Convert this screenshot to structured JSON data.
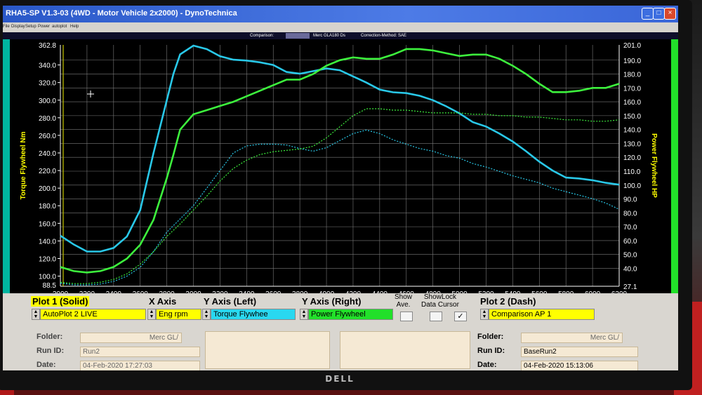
{
  "window": {
    "title": "RHA5-SP V1.3-03   (4WD - Motor Vehicle 2x2000) - DynoTechnica",
    "minimize": "_",
    "maximize": "□",
    "close": "×"
  },
  "menu": [
    "File",
    "Display",
    "Setup",
    "Power",
    "autoplot",
    "Help"
  ],
  "info_bar": {
    "comparison_label": "Comparison:",
    "comparison_value": "Merc GLA180 Ds",
    "correction": "Correction-Method: SAE"
  },
  "colors": {
    "plot_bg": "#000000",
    "torque": "#29c8e8",
    "power": "#3df23d",
    "axis_label": "#ffff00",
    "grid": "#7a7a7a"
  },
  "chart_data": {
    "type": "line",
    "xlabel": "",
    "ylabel": "Torque Flywheel Nm",
    "y2label": "Power Flywheel HP",
    "xlim": [
      2000,
      6200
    ],
    "ylim": [
      88.5,
      362.8
    ],
    "y2lim": [
      27.1,
      201.0
    ],
    "x_ticks": [
      2000,
      2200,
      2400,
      2600,
      2800,
      3000,
      3200,
      3400,
      3600,
      3800,
      4000,
      4200,
      4400,
      4600,
      4800,
      5000,
      5200,
      5400,
      5600,
      5800,
      6000,
      6200
    ],
    "y_ticks": [
      100.0,
      120.0,
      140.0,
      160.0,
      180.0,
      200.0,
      220.0,
      240.0,
      260.0,
      280.0,
      300.0,
      320.0,
      340.0
    ],
    "y_tick_labels": [
      "100.0",
      "120.0",
      "140.0",
      "160.0",
      "180.0",
      "200.0",
      "220.0",
      "240.0",
      "260.0",
      "280.0",
      "300.0",
      "320.0",
      "340.0"
    ],
    "y_top_label": "362.8",
    "y_bottom_label": "88.5",
    "y2_ticks": [
      40.0,
      50.0,
      60.0,
      70.0,
      80.0,
      90.0,
      100.0,
      110.0,
      120.0,
      130.0,
      140.0,
      150.0,
      160.0,
      170.0,
      180.0,
      190.0
    ],
    "y2_tick_labels": [
      "40.0",
      "50.0",
      "60.0",
      "70.0",
      "80.0",
      "90.0",
      "100.0",
      "110.0",
      "120.0",
      "130.0",
      "140.0",
      "150.0",
      "160.0",
      "170.0",
      "180.0",
      "190.0"
    ],
    "y2_top_label": "201.0",
    "y2_bottom_label": "27.1",
    "series": [
      {
        "axis": "left",
        "style": "solid",
        "color": "#29c8e8",
        "x": [
          2000,
          2100,
          2200,
          2300,
          2400,
          2500,
          2600,
          2700,
          2800,
          2850,
          2900,
          3000,
          3100,
          3200,
          3300,
          3400,
          3500,
          3600,
          3700,
          3800,
          3900,
          4000,
          4100,
          4200,
          4300,
          4400,
          4500,
          4600,
          4700,
          4800,
          4900,
          5000,
          5100,
          5200,
          5300,
          5400,
          5500,
          5600,
          5700,
          5800,
          5900,
          6000,
          6100,
          6200
        ],
        "y": [
          146,
          136,
          128,
          128,
          132,
          145,
          175,
          240,
          300,
          330,
          352,
          362,
          358,
          350,
          346,
          345,
          343,
          340,
          332,
          330,
          333,
          336,
          334,
          327,
          320,
          312,
          309,
          308,
          305,
          300,
          293,
          285,
          275,
          270,
          262,
          253,
          242,
          230,
          220,
          212,
          211,
          209,
          206,
          204
        ]
      },
      {
        "axis": "right",
        "style": "solid",
        "color": "#3df23d",
        "x": [
          2000,
          2100,
          2200,
          2300,
          2400,
          2500,
          2600,
          2700,
          2800,
          2850,
          2900,
          3000,
          3100,
          3200,
          3300,
          3400,
          3500,
          3600,
          3700,
          3800,
          3900,
          4000,
          4100,
          4200,
          4300,
          4400,
          4500,
          4600,
          4700,
          4800,
          4900,
          5000,
          5100,
          5200,
          5300,
          5400,
          5500,
          5600,
          5700,
          5800,
          5900,
          6000,
          6100,
          6200
        ],
        "y": [
          41,
          38,
          37,
          38,
          41,
          47,
          57,
          75,
          105,
          122,
          140,
          151,
          154,
          157,
          160,
          164,
          168,
          172,
          176,
          176,
          180,
          186,
          190,
          192,
          191,
          191,
          194,
          198,
          198,
          197,
          195,
          193,
          194,
          194,
          191,
          186,
          180,
          173,
          167,
          167,
          168,
          170,
          170,
          173
        ]
      },
      {
        "axis": "left",
        "style": "dash",
        "color": "#29c8e8",
        "x": [
          2000,
          2100,
          2200,
          2300,
          2400,
          2500,
          2600,
          2700,
          2800,
          2900,
          3000,
          3100,
          3200,
          3300,
          3400,
          3500,
          3600,
          3700,
          3800,
          3900,
          4000,
          4100,
          4200,
          4300,
          4400,
          4500,
          4600,
          4700,
          4800,
          4900,
          5000,
          5100,
          5200,
          5300,
          5400,
          5500,
          5600,
          5700,
          5800,
          5900,
          6000,
          6100,
          6200
        ],
        "y": [
          92,
          90,
          90,
          91,
          94,
          100,
          110,
          128,
          150,
          165,
          180,
          200,
          220,
          240,
          248,
          250,
          250,
          249,
          245,
          242,
          246,
          254,
          262,
          266,
          262,
          255,
          250,
          245,
          242,
          237,
          234,
          228,
          224,
          219,
          214,
          210,
          206,
          200,
          196,
          192,
          188,
          183,
          176
        ]
      },
      {
        "axis": "right",
        "style": "dash",
        "color": "#3df23d",
        "x": [
          2000,
          2100,
          2200,
          2300,
          2400,
          2500,
          2600,
          2700,
          2800,
          2900,
          3000,
          3100,
          3200,
          3300,
          3400,
          3500,
          3600,
          3700,
          3800,
          3900,
          4000,
          4100,
          4200,
          4300,
          4400,
          4500,
          4600,
          4700,
          4800,
          4900,
          5000,
          5100,
          5200,
          5300,
          5400,
          5500,
          5600,
          5700,
          5800,
          5900,
          6000,
          6100,
          6200
        ],
        "y": [
          30,
          29,
          29,
          30,
          32,
          36,
          43,
          52,
          63,
          72,
          82,
          92,
          103,
          112,
          118,
          122,
          124,
          125,
          126,
          128,
          134,
          142,
          150,
          155,
          155,
          154,
          154,
          153,
          152,
          152,
          152,
          151,
          151,
          150,
          150,
          149,
          149,
          148,
          147,
          147,
          146,
          146,
          147
        ]
      }
    ]
  },
  "panel": {
    "plot1_label": "Plot 1 (Solid)",
    "plot1_value": "AutoPlot 2 LIVE",
    "xaxis_label": "X Axis",
    "xaxis_value": "Eng rpm",
    "yleft_label": "Y Axis (Left)",
    "yleft_value": "Torque Flywhee",
    "yright_label": "Y Axis (Right)",
    "yright_value": "Power Flywheel",
    "show_ave_label": "Show\nAve.",
    "showlock_label": "ShowLock\nData Cursor",
    "plot2_label": "Plot 2 (Dash)",
    "plot2_value": "Comparison AP 1",
    "folder_label": "Folder:",
    "folder1_value": "Merc GL/",
    "runid_label": "Run ID:",
    "runid1_value": "Run2",
    "date_label": "Date:",
    "date1_value": "04-Feb-2020   17:27:03",
    "folder2_value": "Merc GL/",
    "runid2_value": "BaseRun2",
    "date2_value": "04-Feb-2020   15:13:06",
    "cursor_checked": "✓"
  },
  "bezel": {
    "brand": "DELL"
  }
}
